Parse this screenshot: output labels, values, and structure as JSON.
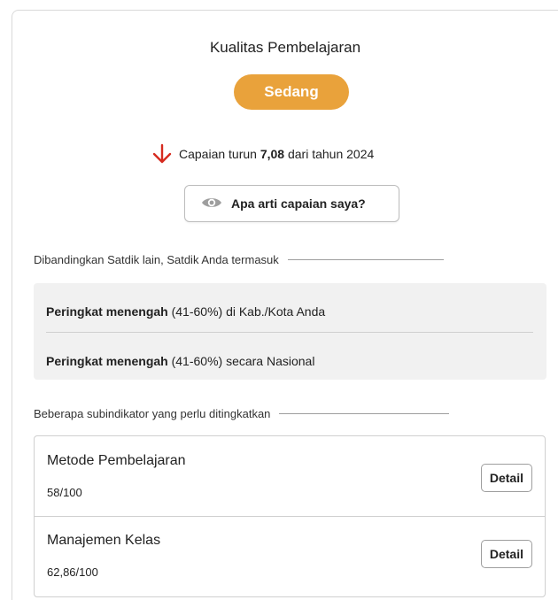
{
  "panel": {
    "title": "Kualitas Pembelajaran",
    "level_badge": "Sedang",
    "level_color": "#e9a23b",
    "change": {
      "icon": "arrow-down-icon",
      "prefix": "Capaian turun",
      "value": "7,08",
      "suffix": "dari tahun 2024",
      "color": "#d62b1f"
    },
    "explain_button": {
      "icon": "eye-icon",
      "label": "Apa arti capaian saya?"
    }
  },
  "comparison": {
    "heading": "Dibandingkan Satdik lain, Satdik Anda termasuk",
    "rows": [
      {
        "bold": "Peringkat menengah",
        "rest": "(41-60%) di Kab./Kota Anda"
      },
      {
        "bold": "Peringkat menengah",
        "rest": "(41-60%) secara Nasional"
      }
    ]
  },
  "subindicators": {
    "heading": "Beberapa subindikator yang perlu ditingkatkan",
    "items": [
      {
        "name": "Metode Pembelajaran",
        "score": "58/100",
        "button": "Detail"
      },
      {
        "name": "Manajemen Kelas",
        "score": "62,86/100",
        "button": "Detail"
      }
    ]
  }
}
